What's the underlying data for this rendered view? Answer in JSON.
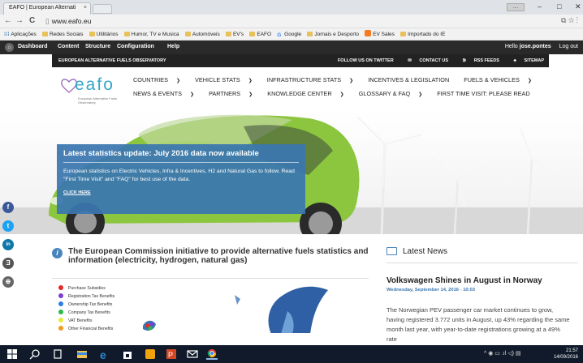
{
  "browser": {
    "tab_title": "EAFO | European Alternati",
    "tab_close": "×",
    "url": "www.eafo.eu",
    "user_chip": "....",
    "win_min": "–",
    "win_max": "□",
    "win_close": "✕",
    "back": "←",
    "forward": "→",
    "reload": "C",
    "page_icon": "▯"
  },
  "bookmarks": {
    "apps": "Aplicações",
    "items": [
      "Redes Sociais",
      "Utilitários",
      "Humor, TV e Musica",
      "Automóveis",
      "EV's",
      "EAFO",
      "Google",
      "Jornais e Desporto",
      "EV Sales",
      "Importado do IE"
    ]
  },
  "admin": {
    "dashboard": "Dashboard",
    "content": "Content",
    "structure": "Structure",
    "configuration": "Configuration",
    "help": "Help",
    "hello": "Hello",
    "user": "jose.pontes",
    "logout": "Log out"
  },
  "site": {
    "observatory": "EUROPEAN ALTERNATIVE FUELS OBSERVATORY",
    "follow": "FOLLOW US ON TWITTER",
    "contact": "CONTACT US",
    "rss": "RSS FEEDS",
    "sitemap": "SITEMAP",
    "logo_name": "eafo",
    "logo_sub": "European Alternative Fuels Observatory",
    "nav_row1": [
      "COUNTRIES",
      "VEHICLE STATS",
      "INFRASTRUCTURE STATS",
      "INCENTIVES & LEGISLATION",
      "FUELS & VEHICLES"
    ],
    "nav_row2": [
      "NEWS & EVENTS",
      "PARTNERS",
      "KNOWLEDGE CENTER",
      "GLOSSARY & FAQ",
      "FIRST TIME VISIT: PLEASE READ"
    ]
  },
  "promo": {
    "title": "Latest statistics update: July 2016 data now available",
    "body": "European statistics on Electric Vehicles, Infra & Incentives, H2 and Natural Gas to follow. Read \"First Time Visit\" and \"FAQ\" for best use of the data.",
    "link": "CLICK HERE"
  },
  "social": [
    "f",
    "t",
    "in",
    "Ǝ",
    "⊕"
  ],
  "initiative": {
    "heading": "The European Commission initiative to provide alternative fuels statistics and information (electricity, hydrogen, natural gas)"
  },
  "legend": [
    {
      "label": "Purchase Subsidies",
      "color": "#e82828"
    },
    {
      "label": "Registration Tax Benefits",
      "color": "#7a3fd1"
    },
    {
      "label": "Ownership Tax Benefits",
      "color": "#2a7de1"
    },
    {
      "label": "Company Tax Benefits",
      "color": "#2db84a"
    },
    {
      "label": "VAT Benefits",
      "color": "#e6ea3c"
    },
    {
      "label": "Other Financial Benefits",
      "color": "#f39a1e"
    }
  ],
  "news": {
    "heading": "Latest News",
    "title": "Volkswagen Shines in August in Norway",
    "date": "Wednesday, September 14, 2016 - 10:03",
    "body": "The Norwegian PEV passenger car market continues to grow, having registered 3.772 units in August, up 43% regarding the same month last year, with year-to-date registrations growing at a 49% rate"
  },
  "taskbar": {
    "time": "21:57",
    "date": "14/09/2016",
    "tray": "^ ◉ ▭ .ıl ◁) ▤"
  },
  "colors": {
    "brand_blue": "#3a76b0",
    "logo_teal": "#35a6c6",
    "car_green": "#8cc63f"
  }
}
